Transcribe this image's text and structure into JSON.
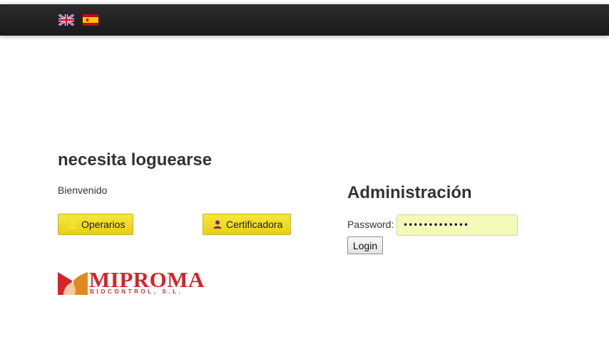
{
  "navbar": {
    "languages": [
      {
        "code": "en",
        "icon": "uk-flag-icon"
      },
      {
        "code": "es",
        "icon": "spain-flag-icon"
      }
    ]
  },
  "main": {
    "title": "necesita loguearse",
    "welcome": "Bienvenido",
    "buttons": {
      "operarios": {
        "label": "Operarios",
        "icon": "user-icon",
        "icon_color": "#f0e62a"
      },
      "certificadora": {
        "label": "Certificadora",
        "icon": "user-icon",
        "icon_color": "#8b1f6b"
      }
    },
    "logo": {
      "name": "MIPROMA",
      "subtitle": "BIOCONTROL, S.L."
    }
  },
  "admin": {
    "title": "Administración",
    "password_label": "Password:",
    "password_value": "•••••••••••••",
    "login_label": "Login"
  },
  "colors": {
    "navbar": "#1f1f1f",
    "button_yellow": "#efdb2a",
    "password_field": "#f4fbb8",
    "logo_red": "#d8232a"
  }
}
